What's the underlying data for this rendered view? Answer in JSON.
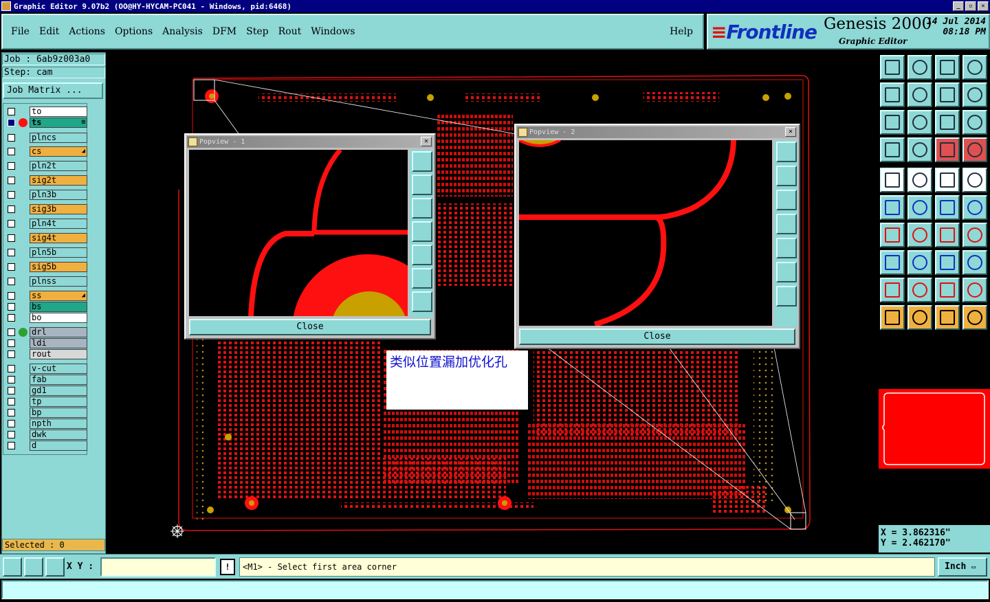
{
  "window": {
    "title": "Graphic Editor 9.07b2 (OO@HY-HYCAM-PC041 - Windows, pid:6468)"
  },
  "menu": [
    "File",
    "Edit",
    "Actions",
    "Options",
    "Analysis",
    "DFM",
    "Step",
    "Rout",
    "Windows"
  ],
  "help_label": "Help",
  "brand": {
    "logo": "Frontline",
    "product": "Genesis 2000",
    "subtitle": "Graphic Editor",
    "date": "14 Jul 2014",
    "time": "08:18 PM"
  },
  "job": {
    "job_line": "Job : 6ab9z003a0",
    "step_line": "Step: cam",
    "matrix_button": "Job Matrix ..."
  },
  "layers": [
    {
      "name": "to",
      "color": "#ffffff",
      "dot": ""
    },
    {
      "name": "ts",
      "color": "#1fa78a",
      "dot": "#ff1010",
      "bold": true,
      "mark": "⊞"
    },
    {
      "name": "plncs",
      "color": "#8ed8d6",
      "dot": ""
    },
    {
      "name": "cs",
      "color": "#f0b040",
      "dot": "",
      "mark": "◢"
    },
    {
      "name": "pln2t",
      "color": "#8ed8d6",
      "dot": ""
    },
    {
      "name": "sig2t",
      "color": "#f0b040",
      "dot": ""
    },
    {
      "name": "pln3b",
      "color": "#8ed8d6",
      "dot": ""
    },
    {
      "name": "sig3b",
      "color": "#f0b040",
      "dot": ""
    },
    {
      "name": "pln4t",
      "color": "#8ed8d6",
      "dot": ""
    },
    {
      "name": "sig4t",
      "color": "#f0b040",
      "dot": ""
    },
    {
      "name": "pln5b",
      "color": "#8ed8d6",
      "dot": ""
    },
    {
      "name": "sig5b",
      "color": "#f0b040",
      "dot": ""
    },
    {
      "name": "plnss",
      "color": "#8ed8d6",
      "dot": ""
    },
    {
      "name": "ss",
      "color": "#f0b040",
      "dot": "",
      "mark": "◢"
    },
    {
      "name": "bs",
      "color": "#1fa78a",
      "dot": ""
    },
    {
      "name": "bo",
      "color": "#ffffff",
      "dot": ""
    },
    {
      "name": "drl",
      "color": "#a8b4c0",
      "dot": "#2ea02e"
    },
    {
      "name": "ldi",
      "color": "#a8b4c0",
      "dot": ""
    },
    {
      "name": "rout",
      "color": "#d8d8d8",
      "dot": ""
    },
    {
      "name": "v-cut",
      "color": "#8ed8d6",
      "dot": ""
    },
    {
      "name": "fab",
      "color": "#8ed8d6",
      "dot": ""
    },
    {
      "name": "gd1",
      "color": "#8ed8d6",
      "dot": ""
    },
    {
      "name": "tp",
      "color": "#8ed8d6",
      "dot": ""
    },
    {
      "name": "bp",
      "color": "#8ed8d6",
      "dot": ""
    },
    {
      "name": "npth",
      "color": "#8ed8d6",
      "dot": ""
    },
    {
      "name": "dwk",
      "color": "#8ed8d6",
      "dot": ""
    },
    {
      "name": "d",
      "color": "#8ed8d6",
      "dot": ""
    }
  ],
  "selected_text": "Selected : 0",
  "popup1": {
    "title": "Popview - 1",
    "close_label": "Close"
  },
  "popup2": {
    "title": "Popview - 2",
    "close_label": "Close"
  },
  "note_text": "类似位置漏加优化孔",
  "coords": {
    "x": "X = 3.862316\"",
    "y": "Y = 2.462170\""
  },
  "bottom": {
    "xy_label": "X Y :",
    "xy_value": "",
    "status": "<M1> - Select first area corner",
    "unit": "Inch"
  },
  "colors": {
    "panel": "#8ed8d6",
    "board_red": "#ff1010",
    "accent_yellow": "#f0b040"
  }
}
